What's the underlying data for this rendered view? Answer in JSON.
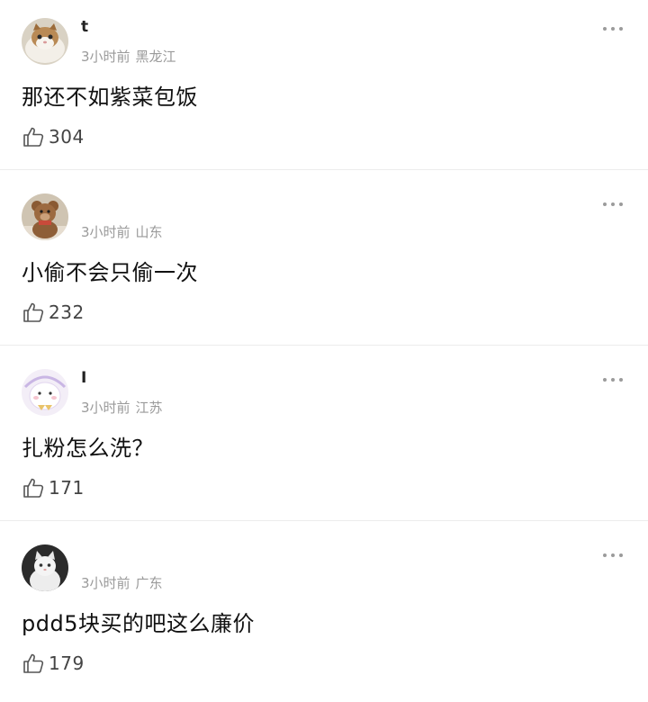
{
  "comments": [
    {
      "username": "t",
      "time": "3小时前",
      "region": "黑龙江",
      "text": "那还不如紫菜包饭",
      "likes": "304",
      "avatar_icon": "cat-photo-icon"
    },
    {
      "username": "",
      "time": "3小时前",
      "region": "山东",
      "text": "小偷不会只偷一次",
      "likes": "232",
      "avatar_icon": "teddy-bear-photo-icon"
    },
    {
      "username": "I",
      "time": "3小时前",
      "region": "江苏",
      "text": "扎粉怎么洗？",
      "likes": "171",
      "avatar_icon": "cartoon-sticker-icon"
    },
    {
      "username": "",
      "time": "3小时前",
      "region": "广东",
      "text": "pdd5块买的吧这么廉价",
      "likes": "179",
      "avatar_icon": "white-cat-photo-icon"
    }
  ],
  "icons": {
    "more": "more-dots-icon",
    "like": "thumbs-up-icon"
  },
  "colors": {
    "meta_text": "#9a9a9a",
    "icon_gray": "#9b9b9b",
    "divider": "#ececec"
  }
}
